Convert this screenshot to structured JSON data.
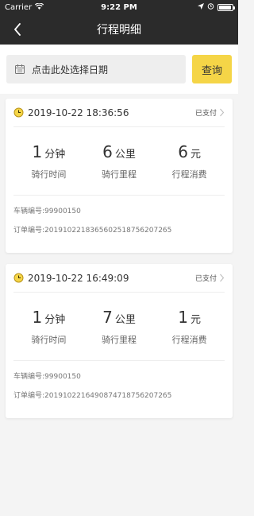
{
  "status_bar": {
    "carrier": "Carrier",
    "time": "9:22 PM",
    "battery_level": 0.95
  },
  "nav": {
    "title": "行程明细"
  },
  "search": {
    "date_placeholder": "点击此处选择日期",
    "query_label": "查询"
  },
  "colors": {
    "accent": "#f5d547",
    "nav_bg": "#2b2b2b"
  },
  "trips": [
    {
      "datetime": "2019-10-22 18:36:56",
      "status": "已支付",
      "stats": [
        {
          "value": "1",
          "unit": "分钟",
          "label": "骑行时间"
        },
        {
          "value": "6",
          "unit": "公里",
          "label": "骑行里程"
        },
        {
          "value": "6",
          "unit": "元",
          "label": "行程消费"
        }
      ],
      "vehicle_label": "车辆编号:",
      "vehicle_no": "99900150",
      "order_label": "订单编号:",
      "order_no": "20191022183656025187562072​65"
    },
    {
      "datetime": "2019-10-22 16:49:09",
      "status": "已支付",
      "stats": [
        {
          "value": "1",
          "unit": "分钟",
          "label": "骑行时间"
        },
        {
          "value": "7",
          "unit": "公里",
          "label": "骑行里程"
        },
        {
          "value": "1",
          "unit": "元",
          "label": "行程消费"
        }
      ],
      "vehicle_label": "车辆编号:",
      "vehicle_no": "99900150",
      "order_label": "订单编号:",
      "order_no": "20191022164908747187562072​65"
    }
  ]
}
